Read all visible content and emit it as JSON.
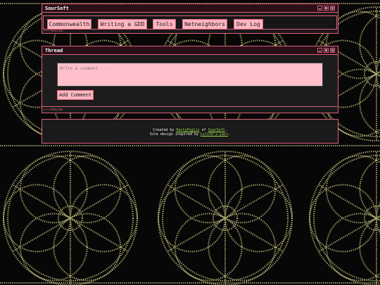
{
  "background": {
    "pattern_name": "ascii-mandala-pattern",
    "glyph_color": "#d6d48a"
  },
  "colors": {
    "accent": "#e0607a",
    "button_fill": "#ffb6c1",
    "input_fill": "#ffc0cb",
    "link": "#9be04a"
  },
  "nav_window": {
    "title": "SourSoft",
    "resize_tag": "⌐⌐⌐resize",
    "items": [
      {
        "label": "Commonwealth"
      },
      {
        "label": "Writing a GDD"
      },
      {
        "label": "Tools"
      },
      {
        "label": "Netneighbors"
      },
      {
        "label": "Dev Log"
      }
    ]
  },
  "thread_window": {
    "title": "Thread",
    "comment_placeholder": "Write a comment...",
    "add_comment_label": "Add Comment",
    "resize_tag": "⌐⌐⌐resize"
  },
  "footer": {
    "created_by": "Created by",
    "author": "PartyPiglin",
    "of": "of",
    "org": "SourSoft",
    "period": ".",
    "inspired_by": "Site design inspired by",
    "inspiration": "Lilith's Lair",
    "period2": "."
  }
}
